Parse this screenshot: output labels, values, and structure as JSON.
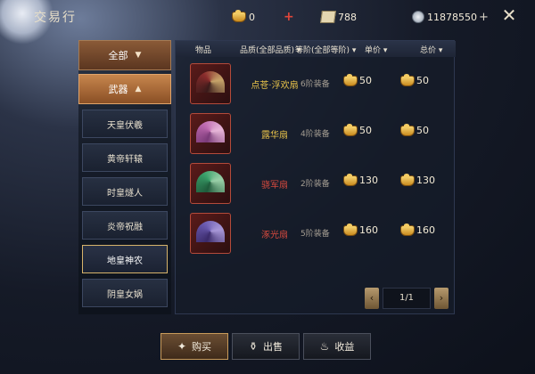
{
  "header": {
    "title": "交易行"
  },
  "currency": {
    "ingot": "0",
    "ticket": "788",
    "silver": "11878550"
  },
  "colors": {
    "gold": "#e7c24a",
    "purple": "#c75a7a",
    "red": "#e0453a"
  },
  "filters": {
    "all": "全部",
    "weapon": "武器"
  },
  "subcategories": [
    "天皇伏羲",
    "黄帝轩辕",
    "时皇燧人",
    "炎帝祝融",
    "地皇神农",
    "阴皇女娲"
  ],
  "table": {
    "headers": [
      "物品",
      "品质(全部品质)",
      "等阶(全部等阶)",
      "单价",
      "总价"
    ],
    "rows": [
      {
        "name": "点苍·浮欢扇",
        "tier": "6阶装备",
        "unit": "50",
        "total": "50",
        "color": "#e7c24a"
      },
      {
        "name": "露华扇",
        "tier": "4阶装备",
        "unit": "50",
        "total": "50",
        "color": "#e7c24a"
      },
      {
        "name": "骁军扇",
        "tier": "2阶装备",
        "unit": "130",
        "total": "130",
        "color": "#d64a3e"
      },
      {
        "name": "涿光扇",
        "tier": "5阶装备",
        "unit": "160",
        "total": "160",
        "color": "#d64a3e"
      }
    ]
  },
  "pager": {
    "page": "1/1"
  },
  "tabs": {
    "buy": "购买",
    "sell": "出售",
    "income": "收益"
  }
}
